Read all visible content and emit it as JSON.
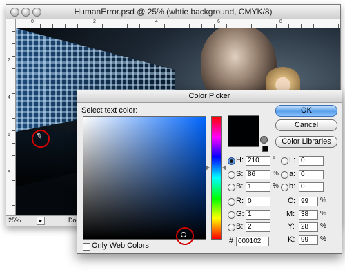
{
  "document": {
    "title": "HumanError.psd @ 25% (whtie background, CMYK/8)",
    "zoom": "25%",
    "info": "Doc",
    "ruler_top": [
      "0",
      "2",
      "4",
      "6",
      "8"
    ],
    "ruler_left": [
      "2",
      "4",
      "6",
      "8"
    ]
  },
  "picker": {
    "title": "Color Picker",
    "prompt": "Select text color:",
    "ok_label": "OK",
    "cancel_label": "Cancel",
    "libraries_label": "Color Libraries",
    "only_web_label": "Only Web Colors",
    "hsb": [
      {
        "label": "H:",
        "value": "210",
        "unit": "°",
        "selected": true
      },
      {
        "label": "S:",
        "value": "86",
        "unit": "%",
        "selected": false
      },
      {
        "label": "B:",
        "value": "1",
        "unit": "%",
        "selected": false
      }
    ],
    "rgb": [
      {
        "label": "R:",
        "value": "0"
      },
      {
        "label": "G:",
        "value": "1"
      },
      {
        "label": "B:",
        "value": "2"
      }
    ],
    "lab": [
      {
        "label": "L:",
        "value": "0"
      },
      {
        "label": "a:",
        "value": "0"
      },
      {
        "label": "b:",
        "value": "0"
      }
    ],
    "cmyk": [
      {
        "label": "C:",
        "value": "99",
        "unit": "%"
      },
      {
        "label": "M:",
        "value": "38",
        "unit": "%"
      },
      {
        "label": "Y:",
        "value": "28",
        "unit": "%"
      },
      {
        "label": "K:",
        "value": "99",
        "unit": "%"
      }
    ],
    "hex_label": "#",
    "hex_value": "000102",
    "current_color": "#000102"
  },
  "colors": {
    "highlight_circle": "#d40000",
    "ok_button": "#5aa0ea"
  }
}
